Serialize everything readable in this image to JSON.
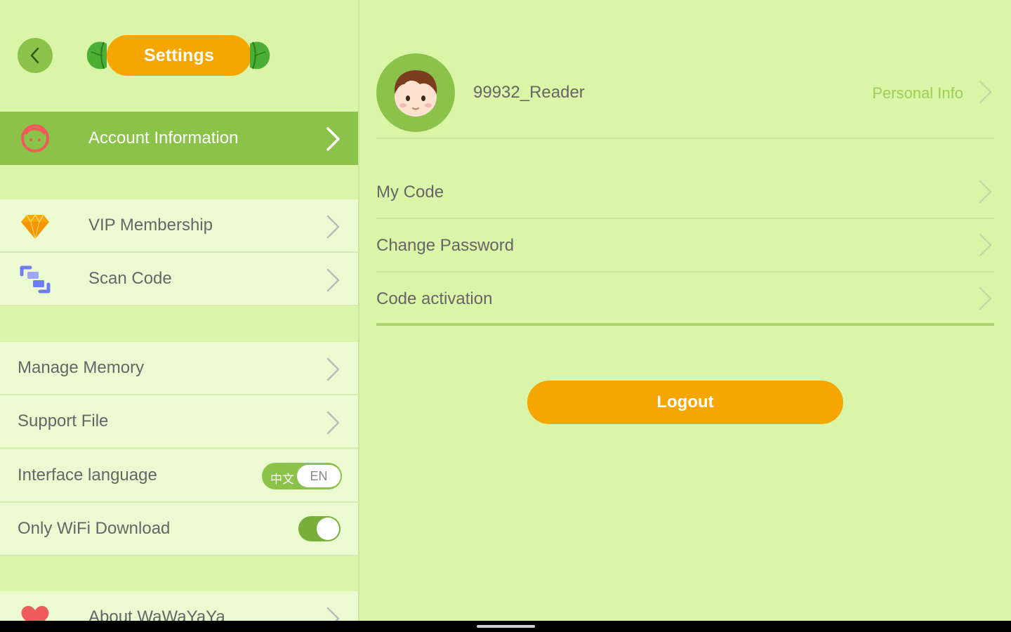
{
  "header": {
    "title": "Settings",
    "back_icon": "chevron-left-icon"
  },
  "sidebar": {
    "items": [
      {
        "label": "Account Information",
        "icon": "face-icon",
        "active": true
      },
      {
        "label": "VIP Membership",
        "icon": "diamond-icon"
      },
      {
        "label": "Scan Code",
        "icon": "scan-icon"
      },
      {
        "label": "Manage Memory"
      },
      {
        "label": "Support File"
      },
      {
        "label": "Interface language",
        "toggle": {
          "left": "中文",
          "right": "EN",
          "selected": "EN"
        }
      },
      {
        "label": "Only WiFi Download",
        "toggle": {
          "state": "on"
        }
      },
      {
        "label": "About WaWaYaYa",
        "icon": "heart-icon"
      }
    ]
  },
  "account": {
    "username": "99932_Reader",
    "personal_info_label": "Personal Info",
    "rows": [
      {
        "label": "My Code"
      },
      {
        "label": "Change Password"
      },
      {
        "label": "Code activation"
      }
    ],
    "logout_label": "Logout"
  },
  "colors": {
    "background": "#daf4a8",
    "accent_green": "#8bc34a",
    "accent_orange": "#f5a600",
    "item_bg": "#ecfad2"
  }
}
